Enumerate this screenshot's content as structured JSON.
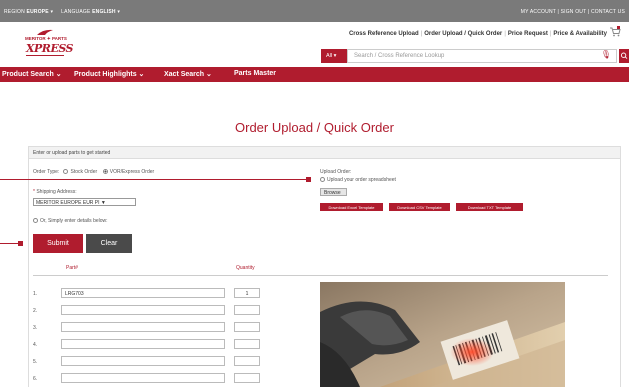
{
  "topbar": {
    "region_label": "REGION",
    "region_value": "EUROPE",
    "language_label": "LANGUAGE",
    "language_value": "ENGLISH",
    "account_links": "MY ACCOUNT | SIGN OUT | CONTACT US"
  },
  "header": {
    "logo_top": "MERITOR ✦ PARTS",
    "logo_main": "XPRESS",
    "links": [
      "Cross Reference Upload",
      "Order Upload / Quick Order",
      "Price Request",
      "Price & Availability"
    ],
    "search": {
      "scope": "All",
      "placeholder": "Search / Cross Reference Lookup"
    }
  },
  "nav": {
    "items": [
      "Product Search",
      "Product Highlights",
      "Xact Search",
      "Parts Master"
    ]
  },
  "page": {
    "title": "Order Upload / Quick Order"
  },
  "form": {
    "panel_heading": "Enter or upload parts to get started",
    "order_type_label": "Order Type:",
    "order_type_options": [
      "Stock Order",
      "VOR/Express Order"
    ],
    "order_type_selected": "VOR/Express Order",
    "shipping_label": "Shipping Address:",
    "shipping_value": "MERITOR EUROPE EUR PI",
    "simple_entry_label": "Or, Simply enter details below:",
    "upload_label": "Upload Order:",
    "upload_hint": "Upload your order spreadsheet",
    "browse_label": "Browse",
    "download_buttons": [
      "Download Excel Template",
      "Download CSV Template",
      "Download TXT Template"
    ],
    "submit_label": "Submit",
    "clear_label": "Clear",
    "columns": {
      "part": "Part#",
      "quantity": "Quantity"
    },
    "rows": [
      {
        "num": "1.",
        "part": "LRG703",
        "qty": "1"
      },
      {
        "num": "2.",
        "part": "",
        "qty": ""
      },
      {
        "num": "3.",
        "part": "",
        "qty": ""
      },
      {
        "num": "4.",
        "part": "",
        "qty": ""
      },
      {
        "num": "5.",
        "part": "",
        "qty": ""
      },
      {
        "num": "6.",
        "part": "",
        "qty": ""
      }
    ]
  },
  "colors": {
    "brand_red": "#b01c2e",
    "topbar_gray": "#7a7a7a",
    "clear_gray": "#4a4a4a"
  }
}
